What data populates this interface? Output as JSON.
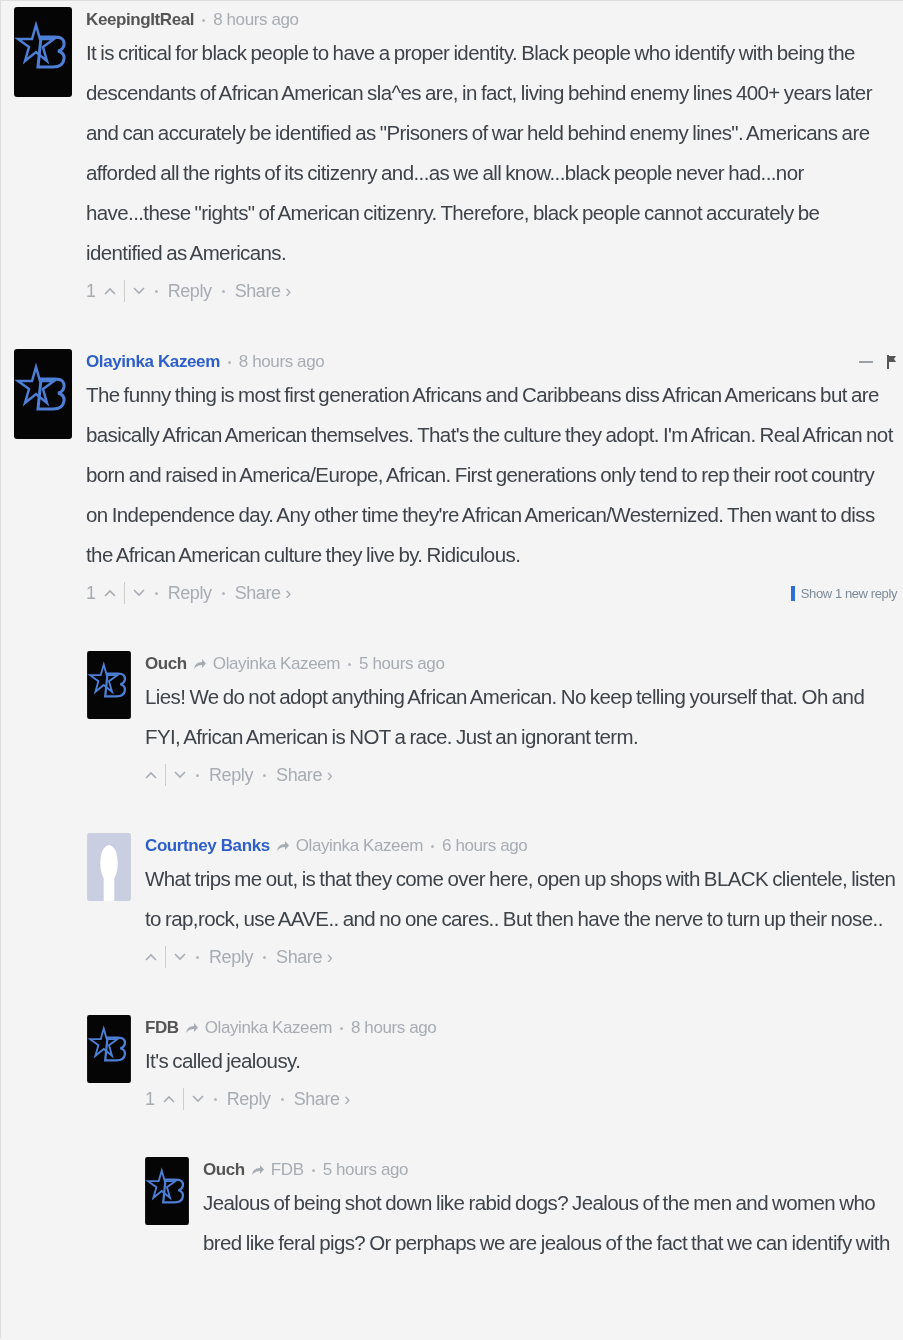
{
  "comments": [
    {
      "author": "KeepingItReal",
      "author_linked": false,
      "avatar": {
        "kind": "logo"
      },
      "time": "8 hours ago",
      "text": "It is critical for black people to have a proper identity. Black people who identify with being the descendants of African American sla^es are, in fact, living behind enemy lines 400+ years later and can accurately be identified as \"Prisoners of war held behind enemy lines\". Americans are afforded all the rights of its citizenry and...as we all know...black people never had...nor have...these \"rights\" of American citizenry. Therefore, black people cannot accurately be identified as Americans.",
      "votes": "1",
      "reply": "Reply",
      "share": "Share ›"
    },
    {
      "author": "Olayinka Kazeem",
      "author_linked": true,
      "avatar": {
        "kind": "logo"
      },
      "time": "8 hours ago",
      "has_menu": true,
      "text": "The funny thing is most first generation Africans and Caribbeans diss African Americans but are basically African American themselves. That's the culture they adopt. I'm African. Real African not born and raised in America/Europe, African. First generations only tend to rep their root country on Independence day. Any other time they're African American/Westernized. Then want to diss the African American culture they live by. Ridiculous.",
      "votes": "1",
      "reply": "Reply",
      "share": "Share ›",
      "new_replies": "Show 1 new reply",
      "children": [
        {
          "author": "Ouch",
          "author_linked": false,
          "reply_to": "Olayinka Kazeem",
          "avatar": {
            "kind": "logo"
          },
          "time": "5 hours ago",
          "text": "Lies! We do not adopt anything African American. No keep telling yourself that. Oh and FYI, African American is NOT a race. Just an ignorant term.",
          "reply": "Reply",
          "share": "Share ›"
        },
        {
          "author": "Courtney Banks",
          "author_linked": true,
          "reply_to": "Olayinka Kazeem",
          "avatar": {
            "kind": "silhouette"
          },
          "time": "6 hours ago",
          "text": "What trips me out, is that they come over here, open up shops with BLACK clientele, listen to rap,rock, use AAVE.. and no one cares.. But then have the nerve to turn up their nose..",
          "reply": "Reply",
          "share": "Share ›"
        },
        {
          "author": "FDB",
          "author_linked": false,
          "reply_to": "Olayinka Kazeem",
          "avatar": {
            "kind": "logo"
          },
          "time": "8 hours ago",
          "text": "It's called jealousy.",
          "votes": "1",
          "reply": "Reply",
          "share": "Share ›",
          "children": [
            {
              "author": "Ouch",
              "author_linked": false,
              "reply_to": "FDB",
              "avatar": {
                "kind": "logo"
              },
              "time": "5 hours ago",
              "text": "Jealous of being shot down like rabid dogs? Jealous of the men and women who bred like feral pigs? Or perphaps we are jealous of the fact that we can identify with"
            }
          ]
        }
      ]
    }
  ]
}
